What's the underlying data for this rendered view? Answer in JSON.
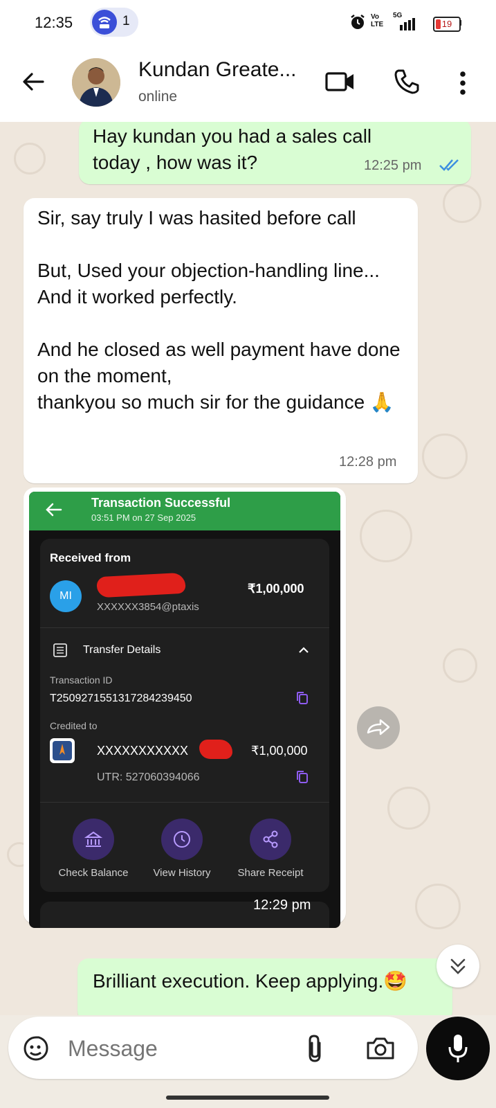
{
  "status_bar": {
    "time": "12:35",
    "notification_count": "1",
    "volte": "Vo\nLTE",
    "network": "5G",
    "battery": "19"
  },
  "header": {
    "contact_name": "Kundan Greate...",
    "contact_status": "online",
    "icons": [
      "back-arrow-icon",
      "video-call-icon",
      "voice-call-icon",
      "more-vert-icon"
    ]
  },
  "messages": [
    {
      "direction": "outgoing",
      "text": "Hay kundan you had a sales call today , how was it?",
      "time": "12:25 pm",
      "ticks": "read"
    },
    {
      "direction": "incoming",
      "text": "Sir, say truly I was hasited before call\n\nBut, Used your objection-handling line...\nAnd it worked perfectly.\n\nAnd he closed as well payment have done on the moment,\nthankyou so much sir for the guidance 🙏",
      "time": "12:28 pm"
    },
    {
      "direction": "incoming",
      "type": "image",
      "time": "12:29 pm"
    },
    {
      "direction": "outgoing",
      "text": "Brilliant execution. Keep applying.🤩"
    }
  ],
  "receipt": {
    "title": "Transaction Successful",
    "datetime": "03:51 PM on 27 Sep 2025",
    "received_from_label": "Received from",
    "sender_initials": "MI",
    "sender_upi": "XXXXXX3854@ptaxis",
    "amount": "₹1,00,000",
    "transfer_details_label": "Transfer Details",
    "transaction_id_label": "Transaction ID",
    "transaction_id": "T2509271551317284239450",
    "credited_to_label": "Credited to",
    "account_masked": "XXXXXXXXXXX",
    "credited_amount": "₹1,00,000",
    "utr": "UTR: 527060394066",
    "actions": [
      "Check Balance",
      "View History",
      "Share Receipt"
    ],
    "colors": {
      "header": "#2e9e48",
      "accent": "#8e5cf0",
      "redaction": "#e0201b"
    }
  },
  "input": {
    "placeholder": "Message",
    "icons": [
      "sticker-icon",
      "attach-icon",
      "camera-icon",
      "mic-icon"
    ]
  },
  "colors": {
    "outgoing_bubble": "#d9fdd3",
    "incoming_bubble": "#ffffff",
    "read_tick": "#3d8fe0",
    "chat_bg": "#efe7dd"
  }
}
